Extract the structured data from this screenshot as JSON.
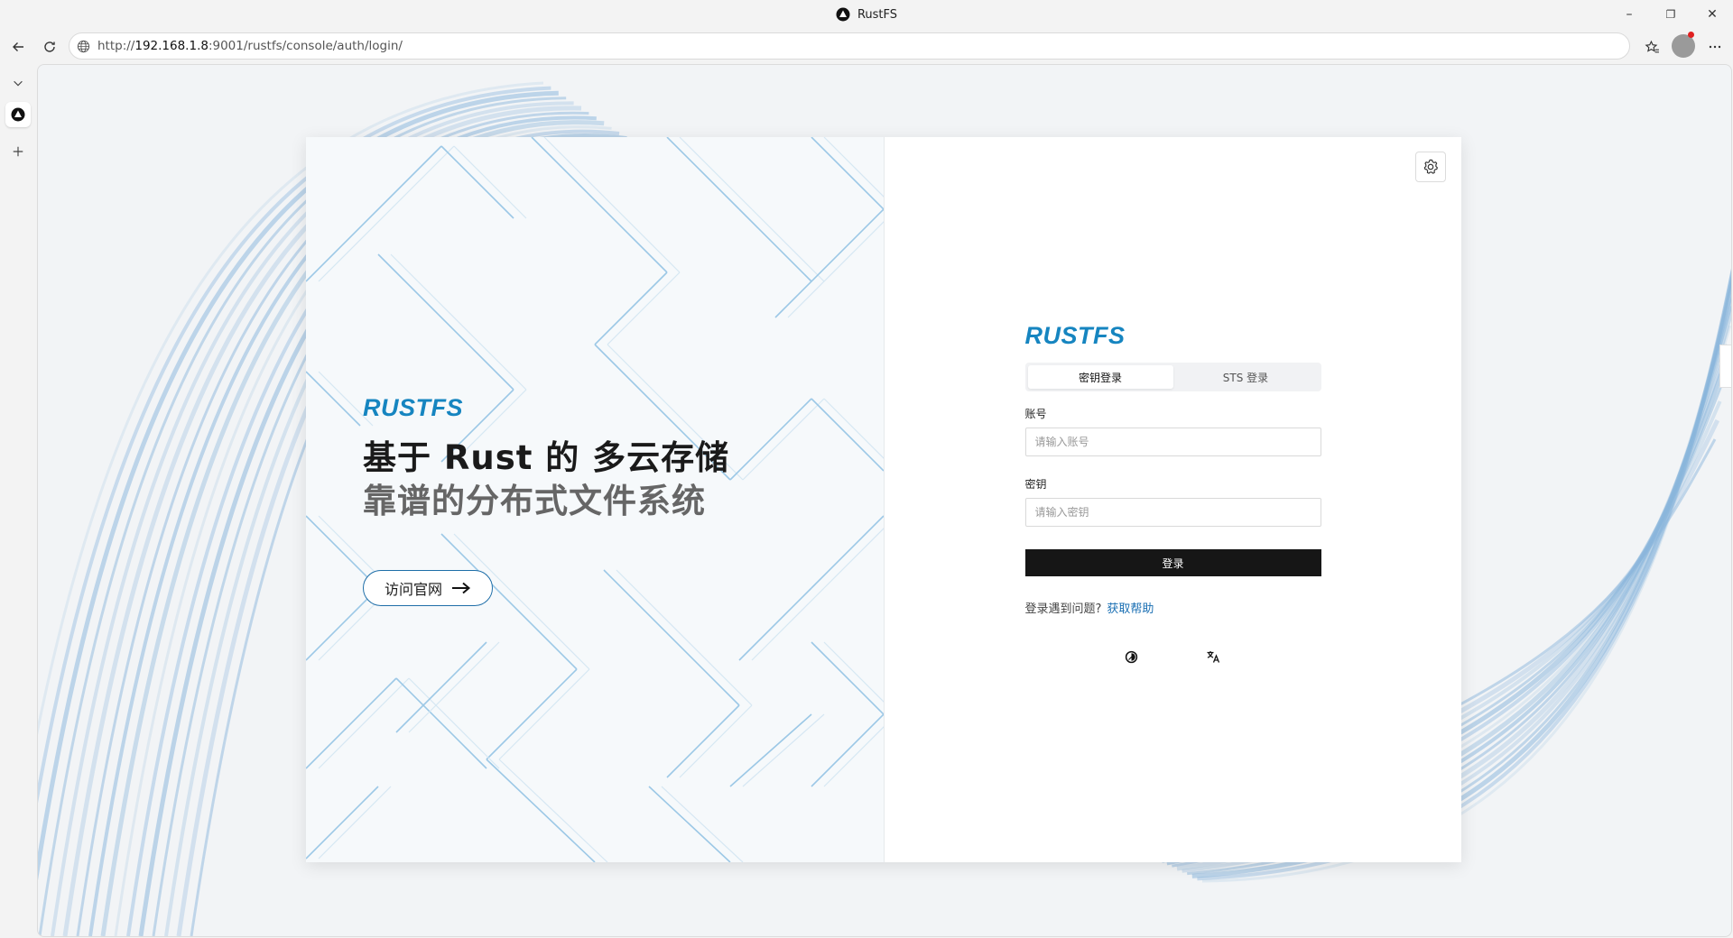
{
  "window": {
    "title": "RustFS",
    "minimize": "–",
    "restore": "❐",
    "close": "✕"
  },
  "toolbar": {
    "url_prefix": "http://",
    "url_host": "192.168.1.8",
    "url_rest": ":9001/rustfs/console/auth/login/"
  },
  "page": {
    "brand": "RUSTFS",
    "headline": "基于 Rust 的 多云存储",
    "subline": "靠谱的分布式文件系统",
    "visit_label": "访问官网",
    "login": {
      "tabs": [
        "密钥登录",
        "STS 登录"
      ],
      "account_label": "账号",
      "account_placeholder": "请输入账号",
      "secret_label": "密钥",
      "secret_placeholder": "请输入密钥",
      "submit_label": "登录",
      "help_text": "登录遇到问题?",
      "help_link": "获取帮助"
    }
  },
  "colors": {
    "brand_blue": "#1685c0",
    "link_blue": "#1a6fb3",
    "button_dark": "#161616"
  },
  "icons": [
    "back-icon",
    "reload-icon",
    "globe-icon",
    "favorites-icon",
    "profile-avatar",
    "more-icon",
    "tab-list-icon",
    "new-tab-icon",
    "settings-gear-icon",
    "arrow-right-icon",
    "theme-toggle-icon",
    "translate-icon"
  ]
}
